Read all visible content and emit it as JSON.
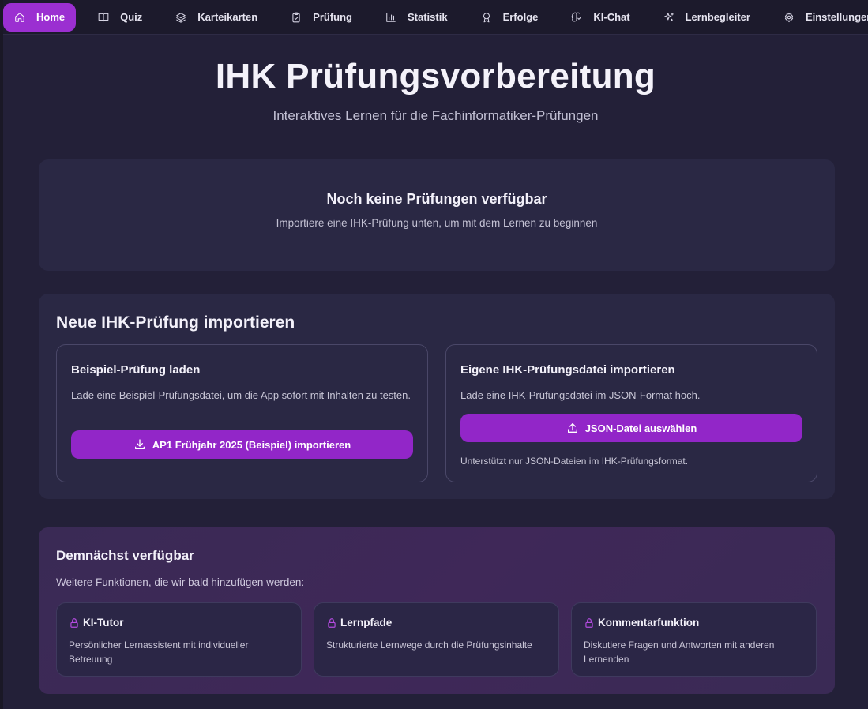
{
  "nav": {
    "items": [
      {
        "label": "Home",
        "icon": "home-icon",
        "active": true
      },
      {
        "label": "Quiz",
        "icon": "book-icon",
        "active": false
      },
      {
        "label": "Karteikarten",
        "icon": "layers-icon",
        "active": false
      },
      {
        "label": "Prüfung",
        "icon": "clipboard-check-icon",
        "active": false
      },
      {
        "label": "Statistik",
        "icon": "bar-chart-icon",
        "active": false
      },
      {
        "label": "Erfolge",
        "icon": "award-icon",
        "active": false
      },
      {
        "label": "KI-Chat",
        "icon": "brain-icon",
        "active": false
      },
      {
        "label": "Lernbegleiter",
        "icon": "sparkles-icon",
        "active": false
      },
      {
        "label": "Einstellungen",
        "icon": "gear-icon",
        "active": false
      }
    ]
  },
  "hero": {
    "title": "IHK Prüfungsvorbereitung",
    "subtitle": "Interaktives Lernen für die Fachinformatiker-Prüfungen"
  },
  "empty_state": {
    "title": "Noch keine Prüfungen verfügbar",
    "subtitle": "Importiere eine IHK-Prüfung unten, um mit dem Lernen zu beginnen"
  },
  "import": {
    "title": "Neue IHK-Prüfung importieren",
    "sample": {
      "title": "Beispiel-Prüfung laden",
      "description": "Lade eine Beispiel-Prüfungsdatei, um die App sofort mit Inhalten zu testen.",
      "button_label": "AP1 Frühjahr 2025 (Beispiel) importieren"
    },
    "custom": {
      "title": "Eigene IHK-Prüfungsdatei importieren",
      "description": "Lade eine IHK-Prüfungsdatei im JSON-Format hoch.",
      "button_label": "JSON-Datei auswählen",
      "note": "Unterstützt nur JSON-Dateien im IHK-Prüfungsformat."
    }
  },
  "coming_soon": {
    "title": "Demnächst verfügbar",
    "subtitle": "Weitere Funktionen, die wir bald hinzufügen werden:",
    "features": [
      {
        "title": "KI-Tutor",
        "description": "Persönlicher Lernassistent mit individueller Betreuung",
        "icon": "lock-icon"
      },
      {
        "title": "Lernpfade",
        "description": "Strukturierte Lernwege durch die Prüfungsinhalte",
        "icon": "lock-icon"
      },
      {
        "title": "Kommentarfunktion",
        "description": "Diskutiere Fragen und Antworten mit anderen Lernenden",
        "icon": "lock-icon"
      }
    ]
  },
  "colors": {
    "accent": "#9226c8",
    "background": "#232038",
    "card": "#2a2844"
  }
}
